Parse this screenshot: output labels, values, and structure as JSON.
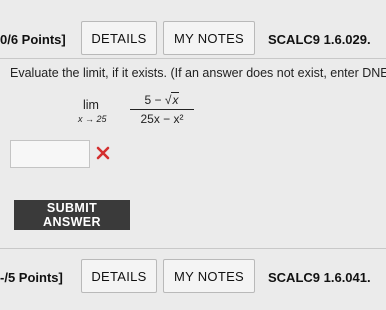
{
  "top_bar": {
    "points": "0/6 Points]",
    "details_label": "DETAILS",
    "my_notes_label": "MY NOTES",
    "problem_code": "SCALC9 1.6.029."
  },
  "problem": {
    "prompt": "Evaluate the limit, if it exists. (If an answer does not exist, enter DNE.)",
    "limit_word": "lim",
    "limit_subscript": "x → 25",
    "numerator_const": "5 − ",
    "numerator_sqrt_var": "x",
    "denominator": "25x − x²"
  },
  "answer": {
    "value": "",
    "status": "incorrect"
  },
  "submit_label": "SUBMIT ANSWER",
  "bottom_bar": {
    "points": "-/5 Points]",
    "details_label": "DETAILS",
    "my_notes_label": "MY NOTES",
    "problem_code": "SCALC9 1.6.041."
  },
  "colors": {
    "background": "#ebebeb",
    "incorrect_mark": "#d32f2f",
    "submit_bg": "#3a3a3a"
  }
}
